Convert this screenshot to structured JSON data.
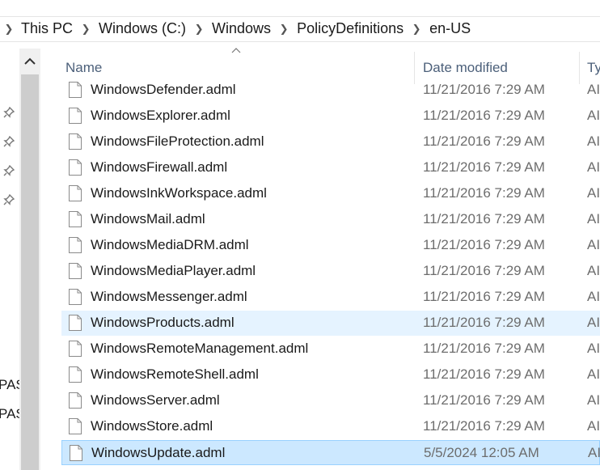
{
  "breadcrumb": {
    "items": [
      "This PC",
      "Windows (C:)",
      "Windows",
      "PolicyDefinitions",
      "en-US"
    ]
  },
  "navigation": {
    "partial_labels": [
      "PAS",
      "PAS"
    ]
  },
  "columns": {
    "name": "Name",
    "date_modified": "Date modified",
    "type": "Ty"
  },
  "files": [
    {
      "name": "WindowsDefender.adml",
      "date": "11/21/2016 7:29 AM",
      "type": "AI",
      "state": "normal"
    },
    {
      "name": "WindowsExplorer.adml",
      "date": "11/21/2016 7:29 AM",
      "type": "AI",
      "state": "normal"
    },
    {
      "name": "WindowsFileProtection.adml",
      "date": "11/21/2016 7:29 AM",
      "type": "AI",
      "state": "normal"
    },
    {
      "name": "WindowsFirewall.adml",
      "date": "11/21/2016 7:29 AM",
      "type": "AI",
      "state": "normal"
    },
    {
      "name": "WindowsInkWorkspace.adml",
      "date": "11/21/2016 7:29 AM",
      "type": "AI",
      "state": "normal"
    },
    {
      "name": "WindowsMail.adml",
      "date": "11/21/2016 7:29 AM",
      "type": "AI",
      "state": "normal"
    },
    {
      "name": "WindowsMediaDRM.adml",
      "date": "11/21/2016 7:29 AM",
      "type": "AI",
      "state": "normal"
    },
    {
      "name": "WindowsMediaPlayer.adml",
      "date": "11/21/2016 7:29 AM",
      "type": "AI",
      "state": "normal"
    },
    {
      "name": "WindowsMessenger.adml",
      "date": "11/21/2016 7:29 AM",
      "type": "AI",
      "state": "normal"
    },
    {
      "name": "WindowsProducts.adml",
      "date": "11/21/2016 7:29 AM",
      "type": "AI",
      "state": "hover"
    },
    {
      "name": "WindowsRemoteManagement.adml",
      "date": "11/21/2016 7:29 AM",
      "type": "AI",
      "state": "normal"
    },
    {
      "name": "WindowsRemoteShell.adml",
      "date": "11/21/2016 7:29 AM",
      "type": "AI",
      "state": "normal"
    },
    {
      "name": "WindowsServer.adml",
      "date": "11/21/2016 7:29 AM",
      "type": "AI",
      "state": "normal"
    },
    {
      "name": "WindowsStore.adml",
      "date": "11/21/2016 7:29 AM",
      "type": "AI",
      "state": "normal"
    },
    {
      "name": "WindowsUpdate.adml",
      "date": "5/5/2024 12:05 AM",
      "type": "AI",
      "state": "selected"
    }
  ],
  "colors": {
    "hover_bg": "#e5f3ff",
    "selected_bg": "#cce8ff",
    "selected_border": "#99d1ff",
    "header_text": "#4c607a",
    "secondary_text": "#6d6d6d"
  },
  "icons": {
    "breadcrumb_separator": "chevron-right-icon",
    "sort": "sort-up-icon",
    "scroll_up": "chevron-up-icon",
    "pin": "pin-icon",
    "file": "document-icon"
  }
}
